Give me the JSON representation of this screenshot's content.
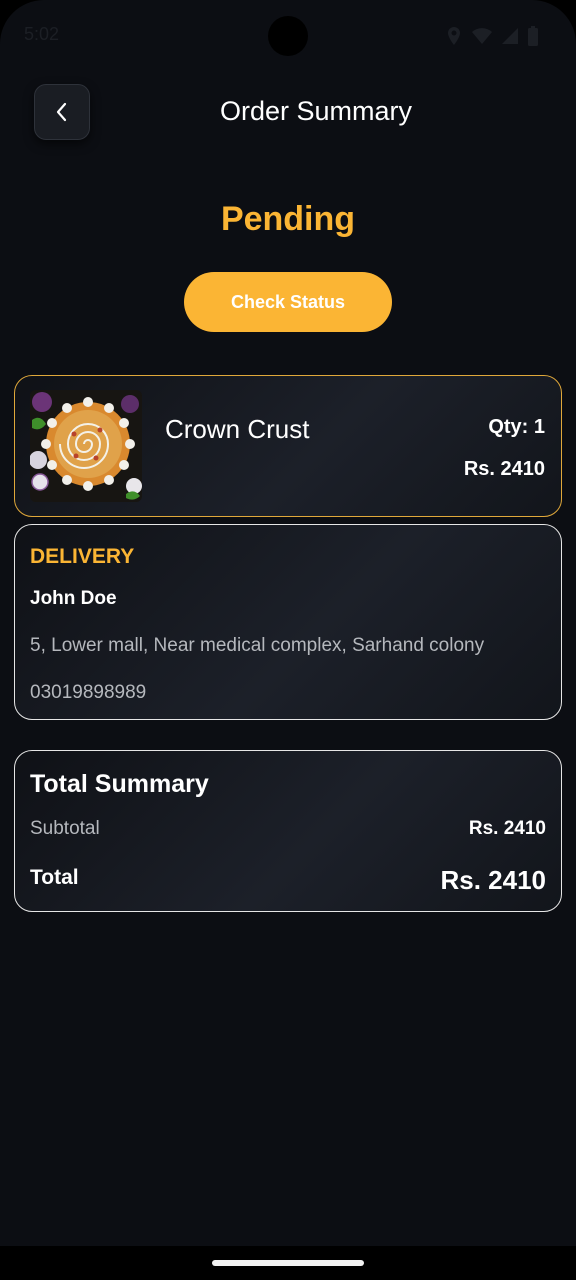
{
  "status_bar": {
    "time": "5:02",
    "icons": [
      "location-icon",
      "wifi-icon",
      "signal-icon",
      "battery-icon"
    ]
  },
  "header": {
    "title": "Order Summary",
    "back_icon": "chevron-left-icon"
  },
  "order": {
    "status": "Pending",
    "check_status_label": "Check Status"
  },
  "item": {
    "name": "Crown Crust",
    "qty": "Qty: 1",
    "price": "Rs. 2410",
    "image": "pizza-image"
  },
  "delivery": {
    "heading": "DELIVERY",
    "name": "John Doe",
    "address": "5, Lower mall, Near medical complex, Sarhand colony",
    "phone": "03019898989"
  },
  "summary": {
    "heading": "Total Summary",
    "subtotal_label": "Subtotal",
    "subtotal_value": "Rs. 2410",
    "total_label": "Total",
    "total_value": "Rs. 2410"
  },
  "colors": {
    "background": "#0c0e13",
    "accent": "#fbb534",
    "text": "#ffffff",
    "muted_text": "#b5b8bd"
  }
}
